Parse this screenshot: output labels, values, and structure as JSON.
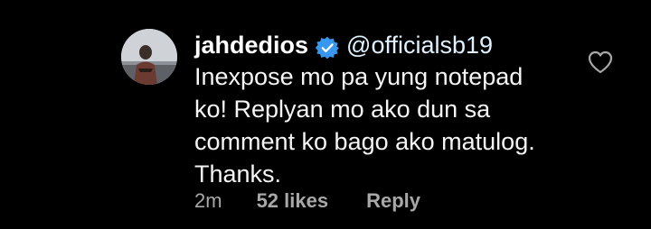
{
  "comment": {
    "avatar_icon": "profile-photo",
    "username": "jahdedios",
    "verified_icon": "verified-badge-icon",
    "mention": "@officialsb19",
    "text_lines": [
      "Inexpose mo pa yung notepad",
      "ko! Replyan mo ako dun sa",
      "comment ko bago ako matulog.",
      "Thanks."
    ],
    "timestamp": "2m",
    "likes": "52 likes",
    "reply_label": "Reply",
    "like_icon": "heart-outline-icon"
  },
  "colors": {
    "background": "#000000",
    "text": "#f5f5f5",
    "meta": "#a8a8a8",
    "verified": "#3897f0"
  }
}
